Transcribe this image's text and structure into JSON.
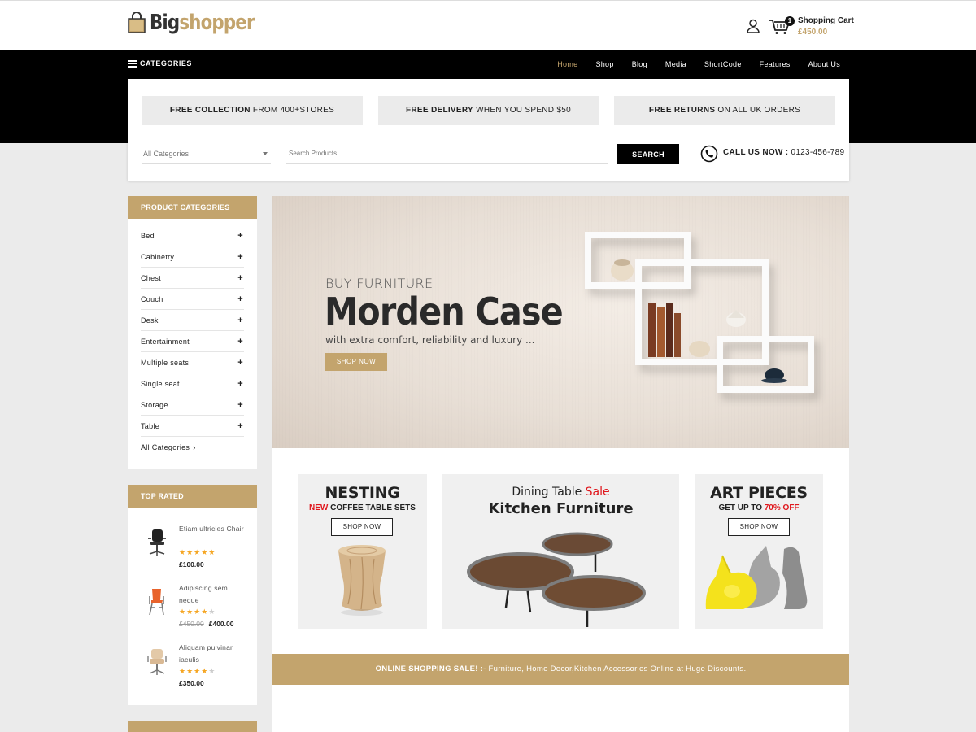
{
  "header": {
    "logo_big": "Big",
    "logo_shopper": "shopper",
    "cart_count": "1",
    "cart_title": "Shopping Cart",
    "cart_total": "£450.00"
  },
  "nav": {
    "categories_label": "CATEGORIES",
    "items": [
      "Home",
      "Shop",
      "Blog",
      "Media",
      "ShortCode",
      "Features",
      "About Us"
    ],
    "active": "Home"
  },
  "promos": [
    {
      "bold": "FREE COLLECTION",
      "rest": " FROM 400+STORES"
    },
    {
      "bold": "FREE DELIVERY",
      "rest": " WHEN YOU SPEND $50"
    },
    {
      "bold": "FREE RETURNS",
      "rest": " ON ALL UK ORDERS"
    }
  ],
  "search": {
    "category_value": "All Categories",
    "placeholder": "Search Products...",
    "button_label": "SEARCH",
    "call_label": "CALL US NOW :",
    "call_number": " 0123-456-789"
  },
  "sidebar": {
    "categories_title": "PRODUCT CATEGORIES",
    "categories": [
      "Bed",
      "Cabinetry",
      "Chest",
      "Couch",
      "Desk",
      "Entertainment",
      "Multiple seats",
      "Single seat",
      "Storage",
      "Table"
    ],
    "all_categories": "All Categories",
    "top_rated_title": "TOP RATED",
    "top_rated": [
      {
        "name": "Etiam ultricies Chair",
        "rating": 5,
        "old_price": "",
        "price": "£100.00"
      },
      {
        "name": "Adipiscing sem neque",
        "rating": 4,
        "old_price": "£450.00",
        "price": "£400.00"
      },
      {
        "name": "Aliquam pulvinar iaculis",
        "rating": 4,
        "old_price": "",
        "price": "£350.00"
      }
    ]
  },
  "hero": {
    "pre": "BUY FURNITURE",
    "title": "Morden Case",
    "sub": "with extra comfort, reliability and luxury ...",
    "button": "SHOP NOW"
  },
  "tiles": {
    "nesting": {
      "title": "NESTING",
      "sub_red": "NEW",
      "sub_rest": " COFFEE TABLE SETS",
      "button": "SHOP NOW"
    },
    "dining": {
      "line1": "Dining Table ",
      "line1_red": "Sale",
      "line2": "Kitchen Furniture"
    },
    "art": {
      "title": "ART PIECES",
      "sub_pre": "GET UP TO ",
      "sub_red": "70% OFF",
      "button": "SHOP NOW"
    }
  },
  "sale_bar": {
    "bold": "ONLINE SHOPPING SALE! :-",
    "rest": " Furniture, Home Decor,Kitchen Accessories Online at Huge Discounts."
  },
  "colors": {
    "accent": "#c3a46d",
    "dark": "#000000",
    "sale_red": "#e0161c",
    "star": "#f5a623",
    "page_bg": "#ebebeb"
  },
  "icons": [
    "bag-logo-icon",
    "user-icon",
    "cart-icon",
    "menu-icon",
    "caret-down-icon",
    "phone-icon",
    "plus-icon",
    "chevron-right-icon",
    "star-icon"
  ]
}
